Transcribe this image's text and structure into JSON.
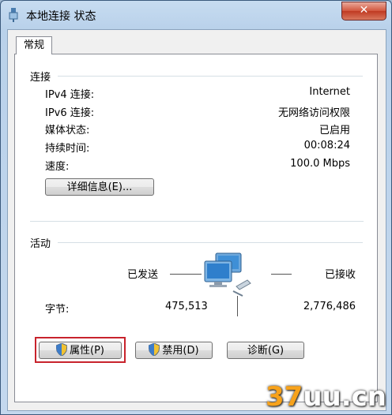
{
  "window": {
    "title": "本地连接 状态",
    "close_glyph": "✕"
  },
  "tabs": [
    {
      "label": "常规"
    }
  ],
  "connection": {
    "heading": "连接",
    "rows": [
      {
        "label": "IPv4 连接:",
        "value": "Internet"
      },
      {
        "label": "IPv6 连接:",
        "value": "无网络访问权限"
      },
      {
        "label": "媒体状态:",
        "value": "已启用"
      },
      {
        "label": "持续时间:",
        "value": "00:08:24"
      },
      {
        "label": "速度:",
        "value": "100.0 Mbps"
      }
    ],
    "details_button": "详细信息(E)..."
  },
  "activity": {
    "heading": "活动",
    "sent_label": "已发送",
    "received_label": "已接收",
    "bytes_label": "字节:",
    "sent_value": "475,513",
    "received_value": "2,776,486",
    "icon": "network-computers-icon"
  },
  "buttons": {
    "properties": "属性(P)",
    "disable": "禁用(D)",
    "diagnose": "诊断(G)"
  },
  "watermark": {
    "prefix": "37",
    "suffix": "uu.cn"
  },
  "colors": {
    "highlight": "#c8232c",
    "watermark_accent": "#f7a21b"
  }
}
